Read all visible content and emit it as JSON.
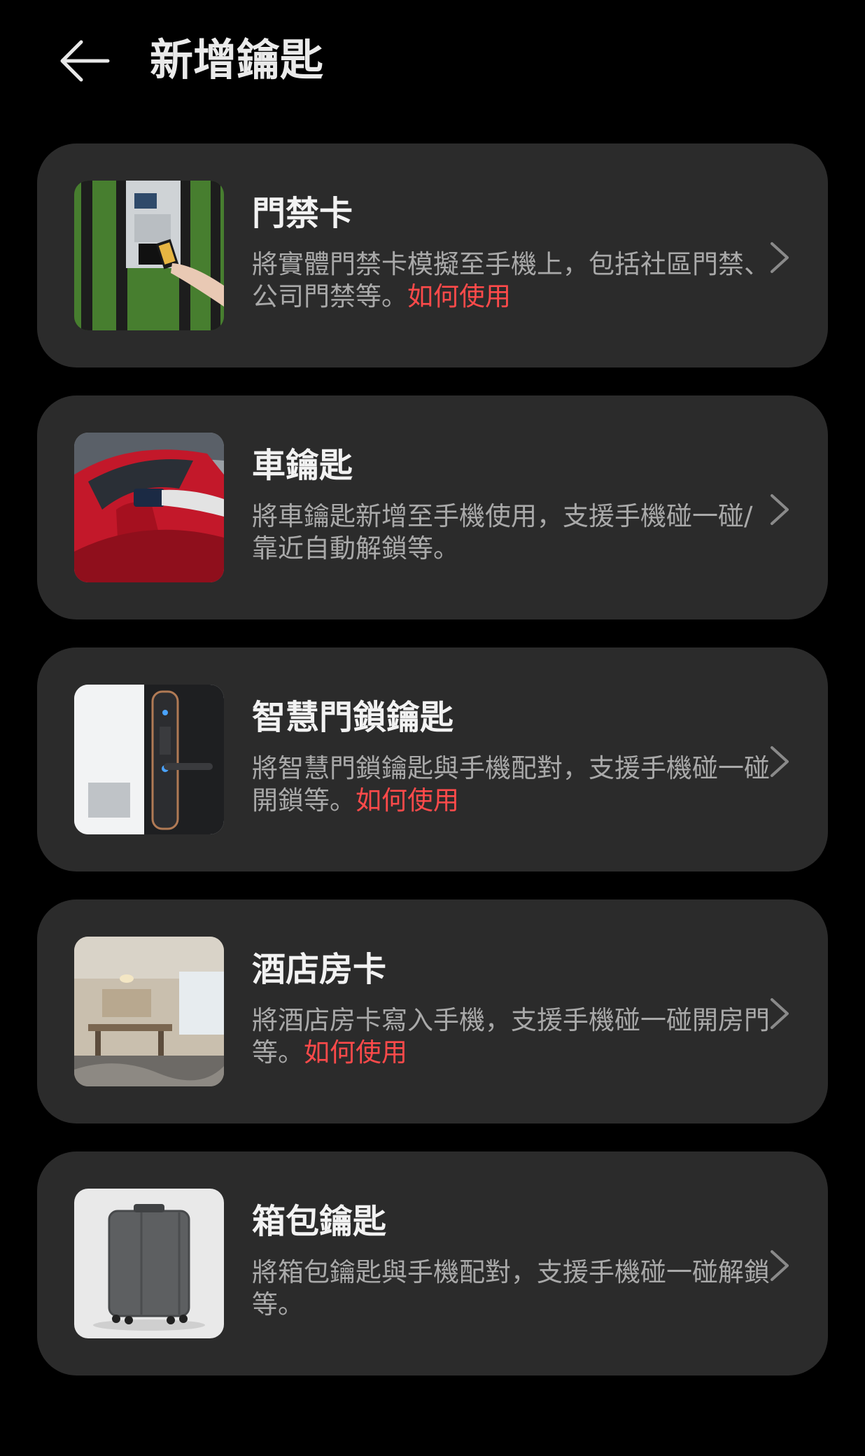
{
  "header": {
    "title": "新增鑰匙"
  },
  "cards": [
    {
      "title": "門禁卡",
      "desc": "將實體門禁卡模擬至手機上，包括社區門禁、公司門禁等。",
      "link": "如何使用"
    },
    {
      "title": "車鑰匙",
      "desc": "將車鑰匙新增至手機使用，支援手機碰一碰/靠近自動解鎖等。",
      "link": ""
    },
    {
      "title": "智慧門鎖鑰匙",
      "desc": "將智慧門鎖鑰匙與手機配對，支援手機碰一碰開鎖等。",
      "link": "如何使用"
    },
    {
      "title": "酒店房卡",
      "desc": "將酒店房卡寫入手機，支援手機碰一碰開房門等。",
      "link": "如何使用"
    },
    {
      "title": "箱包鑰匙",
      "desc": "將箱包鑰匙與手機配對，支援手機碰一碰解鎖等。",
      "link": ""
    }
  ],
  "colors": {
    "background": "#000000",
    "card": "#2b2b2b",
    "link": "#ff4a4a",
    "desc": "#a9a9a9"
  },
  "icons": {
    "back": "arrow-left-icon",
    "chevron": "chevron-right-icon"
  }
}
